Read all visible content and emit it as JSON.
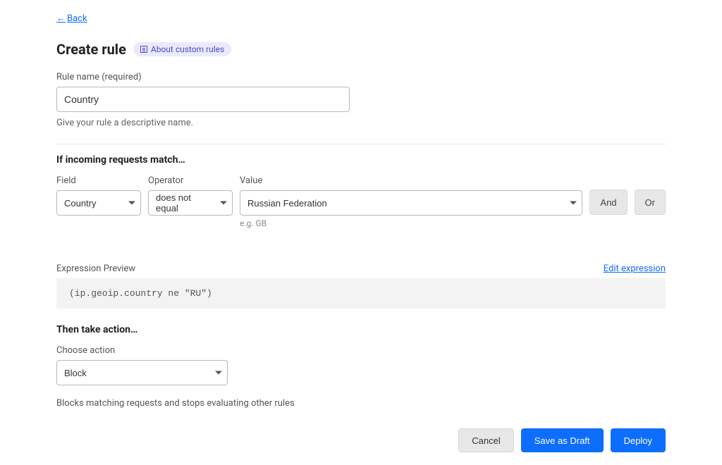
{
  "back": "Back",
  "title": "Create rule",
  "about_badge": "About custom rules",
  "rule_name": {
    "label": "Rule name (required)",
    "value": "Country",
    "helper": "Give your rule a descriptive name."
  },
  "match_section": {
    "title": "If incoming requests match…",
    "field_label": "Field",
    "field_value": "Country",
    "operator_label": "Operator",
    "operator_value": "does not equal",
    "value_label": "Value",
    "value_value": "Russian Federation",
    "value_example": "e.g. GB",
    "and_label": "And",
    "or_label": "Or"
  },
  "expression": {
    "label": "Expression Preview",
    "edit_label": "Edit expression",
    "code": "(ip.geoip.country ne \"RU\")"
  },
  "action": {
    "title": "Then take action…",
    "choose_label": "Choose action",
    "value": "Block",
    "description": "Blocks matching requests and stops evaluating other rules"
  },
  "footer": {
    "cancel": "Cancel",
    "save_draft": "Save as Draft",
    "deploy": "Deploy"
  }
}
